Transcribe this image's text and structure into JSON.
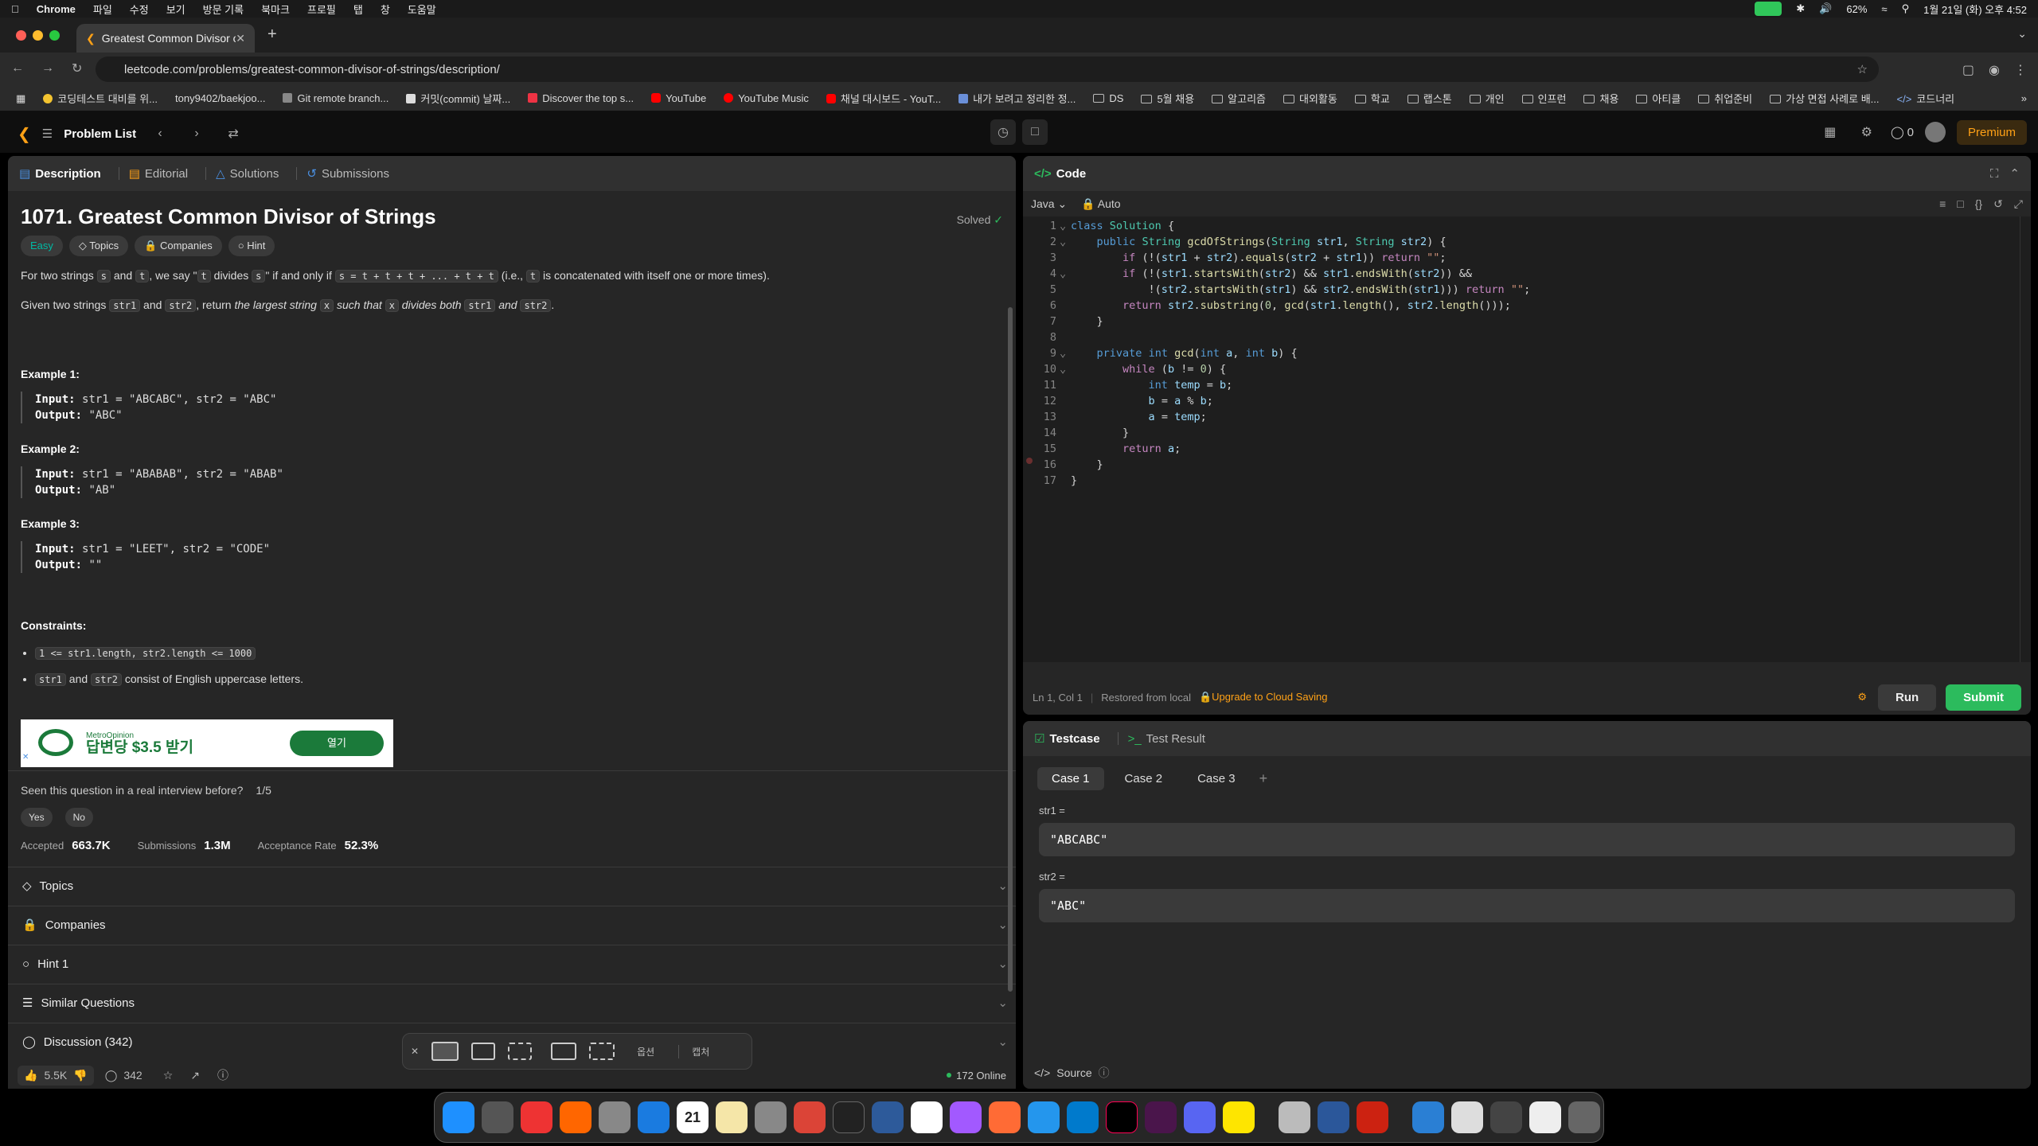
{
  "menubar": {
    "app": "Chrome",
    "items": [
      "파일",
      "수정",
      "보기",
      "방문 기록",
      "북마크",
      "프로필",
      "탭",
      "창",
      "도움말"
    ],
    "battery": "62%",
    "datetime": "1월 21일 (화) 오후 4:52"
  },
  "browser": {
    "tab_title": "Greatest Common Divisor of",
    "url": "leetcode.com/problems/greatest-common-divisor-of-strings/description/",
    "bookmarks": [
      "코딩테스트 대비를 위...",
      "tony9402/baekjoo...",
      "Git remote branch...",
      "커밋(commit) 날짜...",
      "Discover the top s...",
      "YouTube",
      "YouTube Music",
      "채널 대시보드 - YouT...",
      "내가 보려고 정리한 정...",
      "DS",
      "5월 채용",
      "알고리즘",
      "대외활동",
      "학교",
      "랩스톤",
      "개인",
      "인프런",
      "채용",
      "아티클",
      "취업준비",
      "가상 면접 사례로 배...",
      "코드너리"
    ]
  },
  "nav": {
    "problem_list": "Problem List",
    "streak": "0",
    "premium": "Premium"
  },
  "desc": {
    "tabs": [
      "Description",
      "Editorial",
      "Solutions",
      "Submissions"
    ],
    "title": "1071. Greatest Common Divisor of Strings",
    "solved": "Solved",
    "tags": [
      "Easy",
      "Topics",
      "Companies",
      "Hint"
    ],
    "p1a": "For two strings ",
    "p1s": "s",
    "p1b": " and ",
    "p1t": "t",
    "p1c": ", we say \"",
    "p1t2": "t",
    "p1d": " divides ",
    "p1s2": "s",
    "p1e": "\" if and only if ",
    "p1code": "s = t + t + t + ... + t + t",
    "p1f": " (i.e., ",
    "p1t3": "t",
    "p1g": " is concatenated with itself one or more times).",
    "p2a": "Given two strings ",
    "p2s1": "str1",
    "p2b": " and ",
    "p2s2": "str2",
    "p2c": ", return ",
    "p2i": "the largest string ",
    "p2x": "x",
    "p2j": " such that ",
    "p2x2": "x",
    "p2k": " divides both ",
    "p2s3": "str1",
    "p2l": " and ",
    "p2s4": "str2",
    "p2m": ".",
    "examples": [
      {
        "h": "Example 1:",
        "input": "str1 = \"ABCABC\", str2 = \"ABC\"",
        "output": "\"ABC\""
      },
      {
        "h": "Example 2:",
        "input": "str1 = \"ABABAB\", str2 = \"ABAB\"",
        "output": "\"AB\""
      },
      {
        "h": "Example 3:",
        "input": "str1 = \"LEET\", str2 = \"CODE\"",
        "output": "\"\""
      }
    ],
    "input_label": "Input:",
    "output_label": "Output:",
    "constraints_h": "Constraints:",
    "c1": "1 <= str1.length, str2.length <= 1000",
    "c2a": "str1",
    "c2b": " and ",
    "c2c": "str2",
    "c2d": " consist of English uppercase letters.",
    "ad": {
      "brand": "MetroOpinion",
      "text": "답변당 $3.5 받기",
      "btn": "열기"
    },
    "interview_q": "Seen this question in a real interview before?",
    "interview_count": "1/5",
    "yes": "Yes",
    "no": "No",
    "stats": {
      "accepted_l": "Accepted",
      "accepted": "663.7K",
      "subs_l": "Submissions",
      "subs": "1.3M",
      "rate_l": "Acceptance Rate",
      "rate": "52.3%"
    },
    "sections": [
      "Topics",
      "Companies",
      "Hint 1",
      "Similar Questions",
      "Discussion (342)"
    ],
    "likes": "5.5K",
    "comments": "342",
    "online": "172 Online"
  },
  "shotbar": {
    "options": "옵션",
    "capture": "캡처"
  },
  "code": {
    "title": "Code",
    "lang": "Java",
    "auto": "Auto",
    "status_pos": "Ln 1, Col 1",
    "status_restore": "Restored from local",
    "status_upgrade": "Upgrade to Cloud Saving",
    "run": "Run",
    "submit": "Submit"
  },
  "test": {
    "tabs": [
      "Testcase",
      "Test Result"
    ],
    "cases": [
      "Case 1",
      "Case 2",
      "Case 3"
    ],
    "l1": "str1 =",
    "v1": "\"ABCABC\"",
    "l2": "str2 =",
    "v2": "\"ABC\"",
    "source": "Source"
  },
  "dock": {
    "calendar_day": "21"
  }
}
